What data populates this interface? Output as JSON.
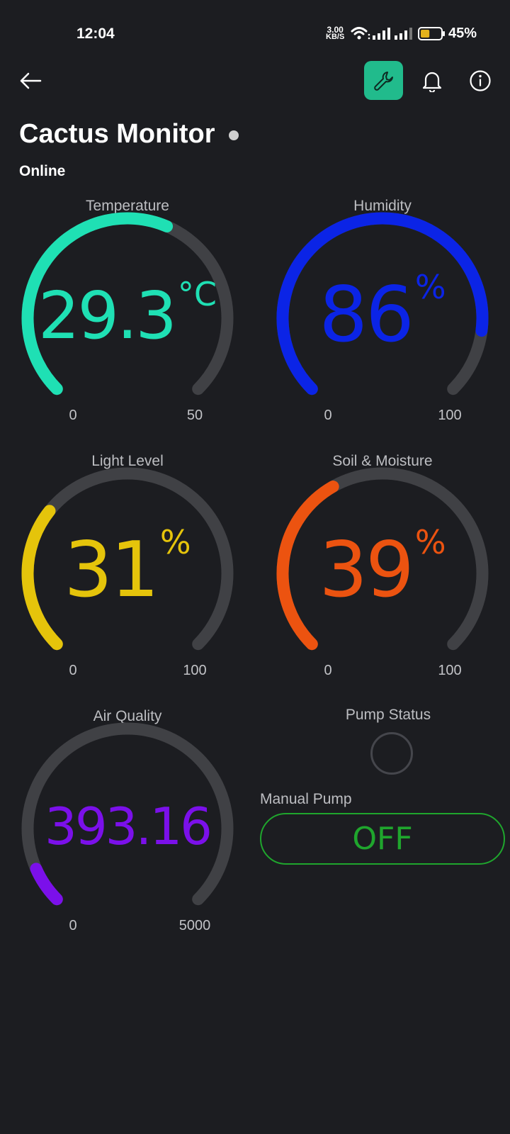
{
  "status_bar": {
    "time": "12:04",
    "net_speed_value": "3.00",
    "net_speed_unit": "KB/S",
    "battery_percent": "45%",
    "battery_level": 0.45
  },
  "header": {
    "back_icon": "arrow-left-icon",
    "actions": [
      "wrench-icon",
      "bell-icon",
      "info-icon"
    ],
    "accent_color": "#21bb8c"
  },
  "device": {
    "title": "Cactus Monitor",
    "status": "Online"
  },
  "gauges": [
    {
      "label": "Temperature",
      "value": "29.3",
      "unit": "°C",
      "min": "0",
      "max": "50",
      "fraction": 0.586,
      "color": "#1fe0b4"
    },
    {
      "label": "Humidity",
      "value": "86",
      "unit": "%",
      "min": "0",
      "max": "100",
      "fraction": 0.86,
      "color": "#0b24e6"
    },
    {
      "label": "Light Level",
      "value": "31",
      "unit": "%",
      "min": "0",
      "max": "100",
      "fraction": 0.31,
      "color": "#e5c40b"
    },
    {
      "label": "Soil & Moisture",
      "value": "39",
      "unit": "%",
      "min": "0",
      "max": "100",
      "fraction": 0.39,
      "color": "#ec5310"
    },
    {
      "label": "Air Quality",
      "value": "393.16",
      "unit": "",
      "min": "0",
      "max": "5000",
      "fraction": 0.0786,
      "color": "#7b10ea"
    }
  ],
  "pump": {
    "status_label": "Pump Status",
    "manual_label": "Manual Pump",
    "button_label": "OFF",
    "button_color": "#1fa62d"
  }
}
